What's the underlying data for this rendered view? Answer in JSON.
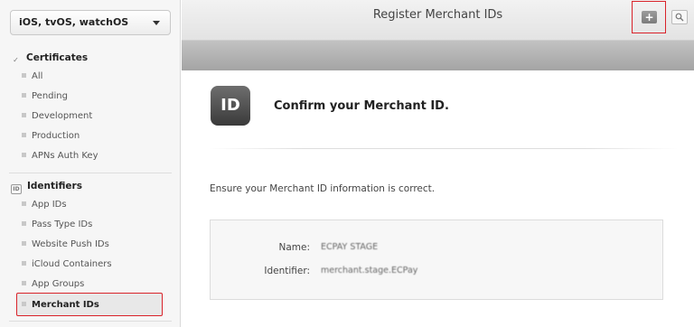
{
  "sidebar": {
    "platform_label": "iOS, tvOS, watchOS",
    "sections": {
      "certificates": {
        "label": "Certificates",
        "items": [
          "All",
          "Pending",
          "Development",
          "Production",
          "APNs Auth Key"
        ]
      },
      "identifiers": {
        "label": "Identifiers",
        "items": [
          "App IDs",
          "Pass Type IDs",
          "Website Push IDs",
          "iCloud Containers",
          "App Groups",
          "Merchant IDs"
        ]
      }
    },
    "active_item": "Merchant IDs"
  },
  "header": {
    "title": "Register Merchant IDs",
    "add_label": "+"
  },
  "main": {
    "id_icon_text": "ID",
    "title": "Confirm your Merchant ID.",
    "instruction": "Ensure your Merchant ID information is correct.",
    "fields": [
      {
        "label": "Name:",
        "value": "ECPAY STAGE"
      },
      {
        "label": "Identifier:",
        "value": "merchant.stage.ECPay"
      }
    ]
  },
  "colors": {
    "highlight": "#d9232a",
    "band": "#a9a9a9"
  },
  "icons": {
    "certificates": "checkmark-circle-icon",
    "identifiers": "id-badge-icon",
    "search": "search-icon",
    "dropdown": "chevron-down-icon"
  }
}
